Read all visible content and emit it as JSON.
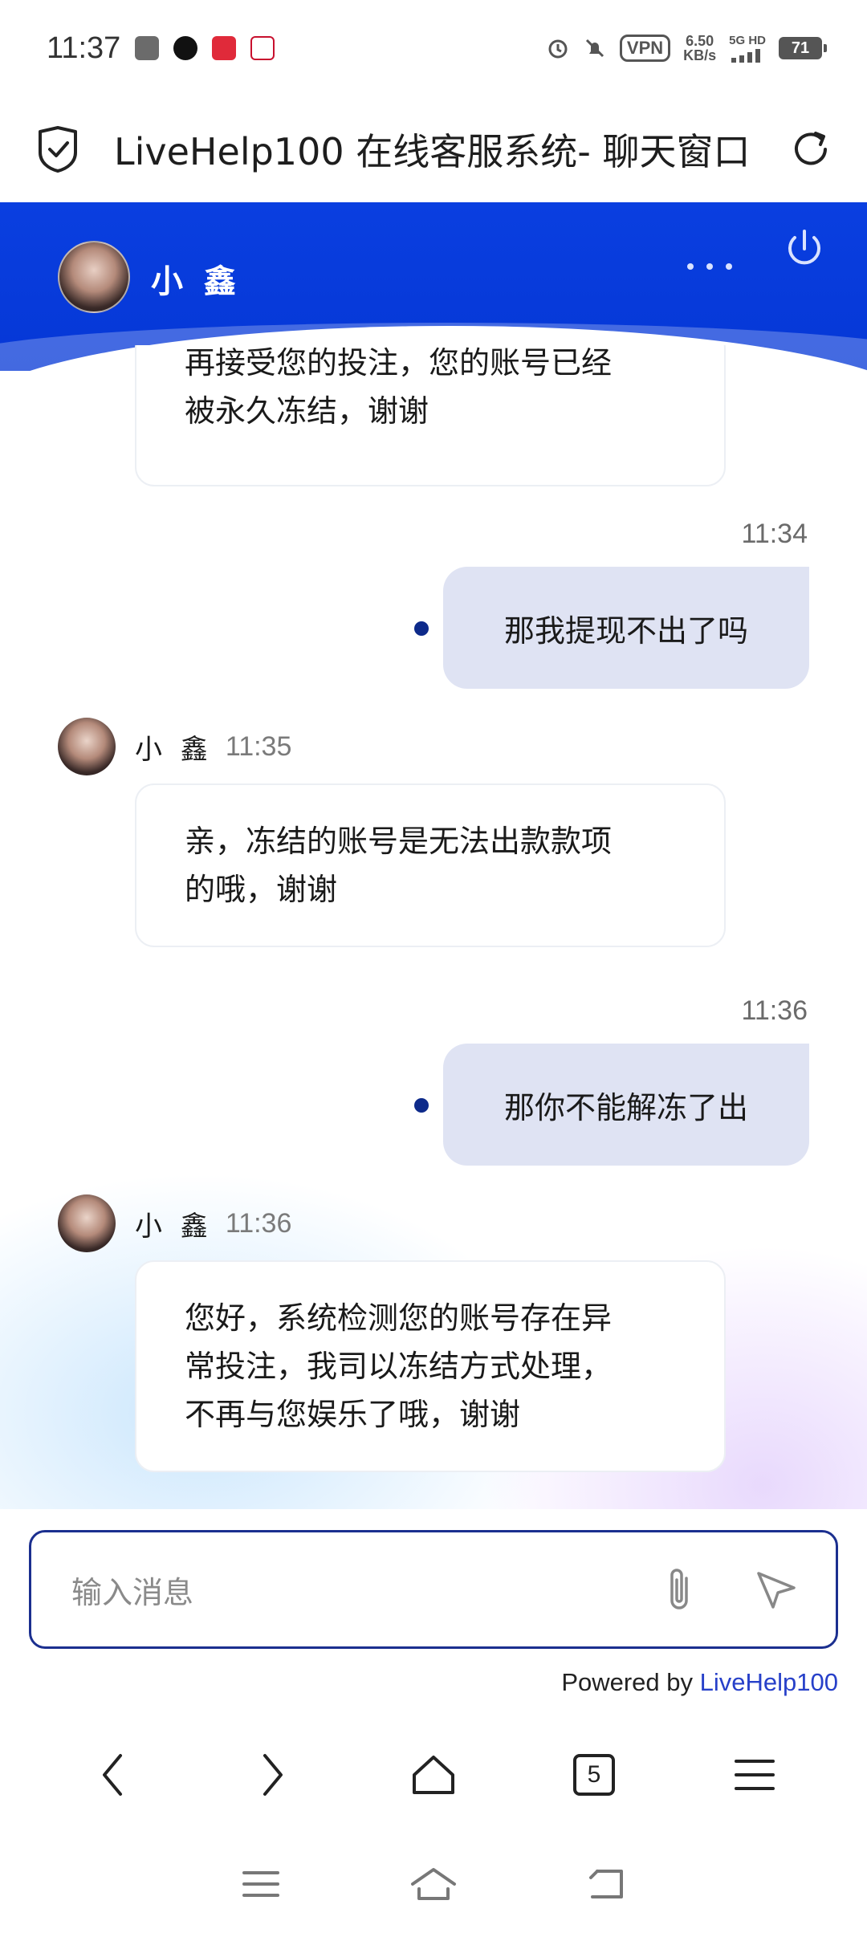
{
  "status_bar": {
    "time": "11:37",
    "vpn": "VPN",
    "net_speed_value": "6.50",
    "net_speed_unit": "KB/s",
    "network": "5G HD",
    "battery": "71"
  },
  "browser": {
    "title": "LiveHelp100 在线客服系统- 聊天窗口",
    "tab_count": "5"
  },
  "chat_header": {
    "agent_name": "小 鑫"
  },
  "messages": [
    {
      "sender": "agent",
      "text_lines": [
        "再接受您的投注，您的账号已经",
        "被永久冻结，谢谢"
      ]
    },
    {
      "sender": "user",
      "time": "11:34",
      "text": "那我提现不出了吗"
    },
    {
      "sender": "agent",
      "name": "小 鑫",
      "time": "11:35",
      "text_lines": [
        "亲，冻结的账号是无法出款款项",
        "的哦，谢谢"
      ]
    },
    {
      "sender": "user",
      "time": "11:36",
      "text": "那你不能解冻了出"
    },
    {
      "sender": "agent",
      "name": "小 鑫",
      "time": "11:36",
      "text_lines": [
        "您好，系统检测您的账号存在异",
        "常投注，我司以冻结方式处理，",
        "不再与您娱乐了哦，谢谢"
      ]
    }
  ],
  "composer": {
    "placeholder": "输入消息",
    "powered_prefix": "Powered by ",
    "powered_brand": "LiveHelp100"
  },
  "colors": {
    "header_blue": "#0a3fe0",
    "user_bubble": "#dfe3f3",
    "accent_dot": "#0d2a8a",
    "brand_link": "#2740c9"
  },
  "icons": [
    "shield-check-icon",
    "reload-icon",
    "more-icon",
    "power-icon",
    "attach-icon",
    "send-icon",
    "back-icon",
    "forward-icon",
    "home-icon",
    "tabs-icon",
    "menu-icon"
  ]
}
